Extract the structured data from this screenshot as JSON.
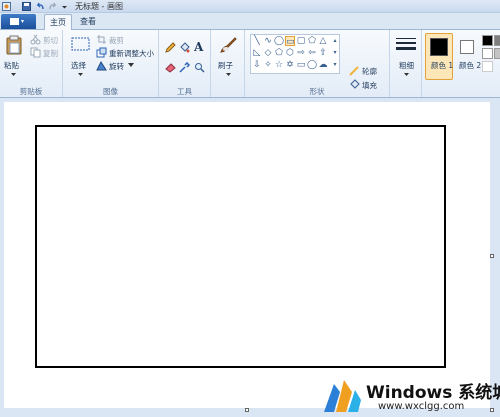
{
  "window": {
    "title": "无标题 - 画图"
  },
  "tabs": [
    {
      "label": "主页",
      "active": true
    },
    {
      "label": "查看",
      "active": false
    }
  ],
  "clipboard": {
    "paste_label": "粘贴",
    "cut_label": "剪切",
    "copy_label": "复制",
    "group_label": "剪贴板"
  },
  "image": {
    "select_label": "选择",
    "crop_label": "裁剪",
    "resize_label": "重新调整大小",
    "rotate_label": "旋转",
    "group_label": "图像"
  },
  "tools": {
    "group_label": "工具",
    "text_tool": "A"
  },
  "brushes": {
    "label": "刷子"
  },
  "shapes": {
    "outline_label": "轮廓",
    "fill_label": "填充",
    "group_label": "形状"
  },
  "size": {
    "label": "粗细"
  },
  "colors": {
    "color1_label": "颜色 1",
    "color1_value": "#000000",
    "color2_label": "颜色 2",
    "color2_value": "#ffffff",
    "palette": [
      "#000000",
      "#7f7f7f",
      "#ffffff",
      "#c3c3c3"
    ]
  },
  "watermark": {
    "title": "Windows 系统城",
    "url": "www.wxclgg.com"
  }
}
